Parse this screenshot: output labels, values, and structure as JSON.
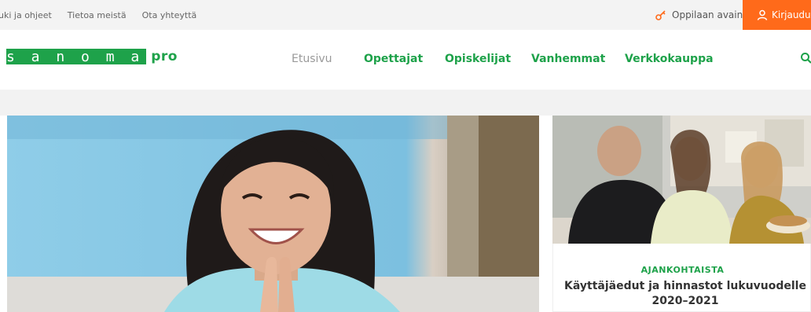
{
  "topbar": {
    "links": [
      "uki ja ohjeet",
      "Tietoa meistä",
      "Ota yhteyttä"
    ],
    "student_key_label": "Oppilaan avain",
    "login_label": "Kirjaudu"
  },
  "brand": {
    "logo_text": "s a n o m a",
    "logo_suffix": "pro",
    "green": "#1ea24a",
    "orange": "#ff6a1a"
  },
  "nav": {
    "items": [
      {
        "label": "Etusivu",
        "active": false
      },
      {
        "label": "Opettajat",
        "active": true
      },
      {
        "label": "Opiskelijat",
        "active": true
      },
      {
        "label": "Vanhemmat",
        "active": true
      },
      {
        "label": "Verkkokauppa",
        "active": true
      }
    ],
    "search_icon": "search-icon"
  },
  "card": {
    "category": "AJANKOHTAISTA",
    "title": "Käyttäjäedut ja hinnastot lukuvuodelle 2020–2021"
  }
}
